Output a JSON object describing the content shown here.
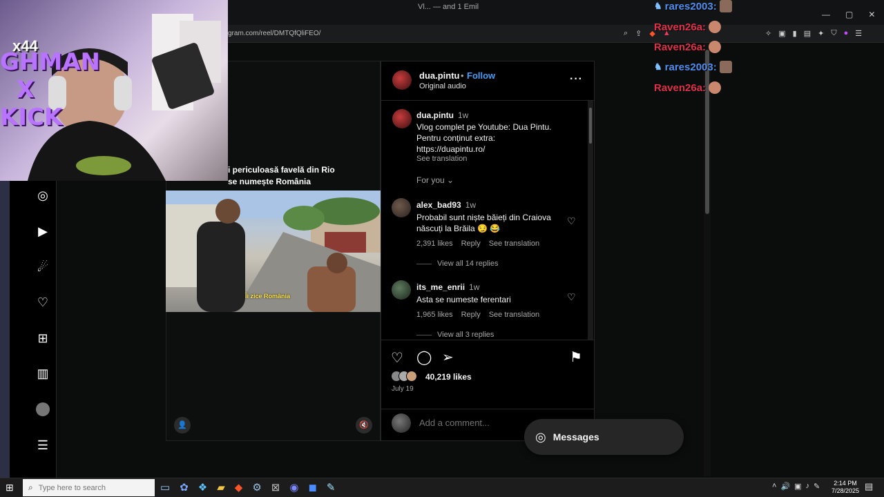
{
  "browser": {
    "tab_title": "Vl... — and 1 Emil",
    "url": "gram.com/reel/DMTQfQliFEO/",
    "window_controls": [
      "—",
      "▢",
      "✕"
    ]
  },
  "reel": {
    "caption_line1": "i periculoasă favelă din Rio",
    "caption_line2": "se numește România",
    "subtitle": "Îi zice România"
  },
  "post": {
    "author": "dua.pintu",
    "separator": "•",
    "follow_label": "Follow",
    "audio": "Original audio",
    "caption": {
      "user": "dua.pintu",
      "time": "1w",
      "line1": "Vlog complet pe Youtube: Dua Pintu.",
      "line2": "Pentru conținut extra:",
      "line3": "https://duapintu.ro/",
      "see_translation": "See translation"
    },
    "sort_label": "For you",
    "comments": [
      {
        "user": "alex_bad93",
        "time": "1w",
        "line1": "Probabil sunt niște băieți din Craiova",
        "line2": "născuți la Brăila 😏 😂",
        "likes": "2,391 likes",
        "reply": "Reply",
        "see_translation": "See translation",
        "view_replies": "View all 14 replies"
      },
      {
        "user": "its_me_enrii",
        "time": "1w",
        "line1": "Asta se numeste ferentari",
        "likes": "1,965 likes",
        "reply": "Reply",
        "see_translation": "See translation",
        "view_replies": "View all 3 replies"
      }
    ],
    "likes_total": "40,219 likes",
    "date": "July 19",
    "add_comment_placeholder": "Add a comment..."
  },
  "messages": {
    "label": "Messages"
  },
  "webcam": {
    "banner": "GHMAN\nX\nKICK",
    "badge": "x44"
  },
  "chat": [
    {
      "user": "rares2003:",
      "color": "#4f8ff0"
    },
    {
      "user": "Raven26a:",
      "color": "#e0304a"
    },
    {
      "user": "Raven26a:",
      "color": "#e0304a"
    },
    {
      "user": "rares2003:",
      "color": "#4f8ff0"
    },
    {
      "user": "Raven26a:",
      "color": "#e0304a"
    }
  ],
  "taskbar": {
    "search_placeholder": "Type here to search",
    "time": "2:14 PM",
    "date": "7/28/2025"
  }
}
